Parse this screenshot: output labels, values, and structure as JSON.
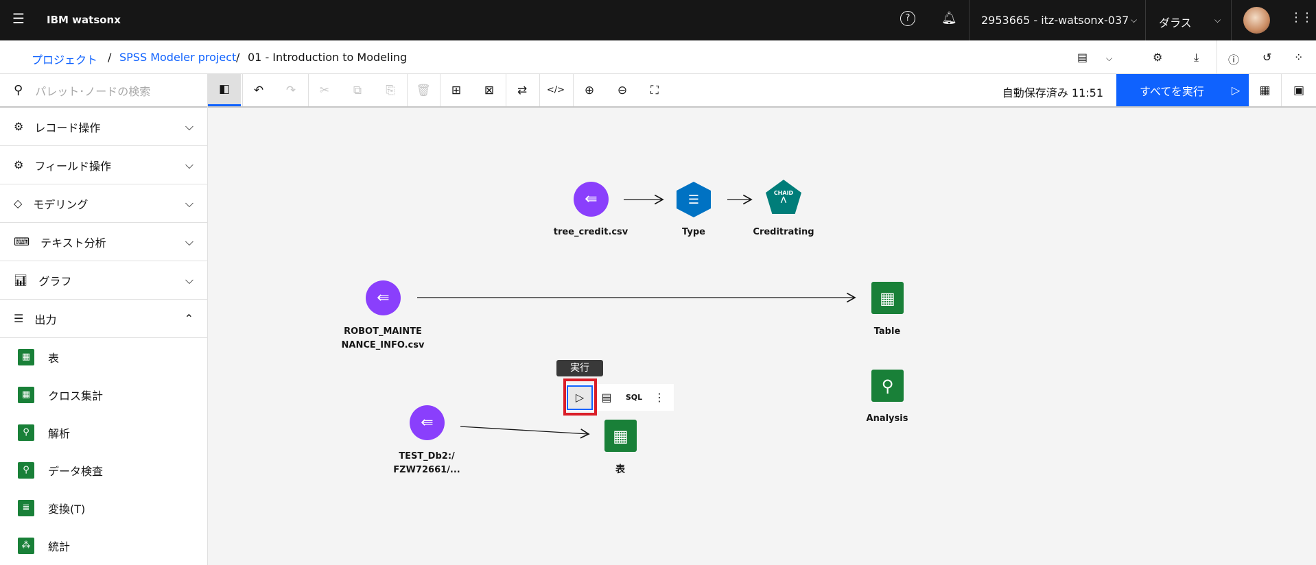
{
  "header": {
    "app_name": "IBM watsonx",
    "account": "2953665 - itz-watsonx-037",
    "region": "ダラス"
  },
  "breadcrumb": {
    "items": [
      "プロジェクト",
      "SPSS Modeler project"
    ],
    "current": "01 - Introduction to Modeling"
  },
  "toolbar": {
    "autosave": "自動保存済み 11:51",
    "run_all": "すべてを実行"
  },
  "sidebar": {
    "search_placeholder": "パレット･ノードの検索",
    "categories": [
      {
        "label": "レコード操作"
      },
      {
        "label": "フィールド操作"
      },
      {
        "label": "モデリング"
      },
      {
        "label": "テキスト分析"
      },
      {
        "label": "グラフ"
      },
      {
        "label": "出力"
      }
    ],
    "output_items": [
      {
        "label": "表"
      },
      {
        "label": "クロス集計"
      },
      {
        "label": "解析"
      },
      {
        "label": "データ検査"
      },
      {
        "label": "変換(T)"
      },
      {
        "label": "統計"
      }
    ]
  },
  "canvas": {
    "nodes": {
      "tree_credit": "tree_credit.csv",
      "type": "Type",
      "creditrating": "Creditrating",
      "chaid": "CHAID",
      "robot1": "ROBOT_MAINTE",
      "robot2": "NANCE_INFO.csv",
      "table": "Table",
      "analysis": "Analysis",
      "test1": "TEST_Db2:/",
      "test2": "FZW72661/...",
      "hyo": "表"
    },
    "tooltip": "実行",
    "node_toolbar": {
      "sql": "SQL"
    }
  },
  "colors": {
    "accent": "#0f62fe",
    "import": "#8a3ffc",
    "output": "#198038",
    "field": "#0072c3",
    "model": "#007d79",
    "highlight": "#da1e28"
  }
}
